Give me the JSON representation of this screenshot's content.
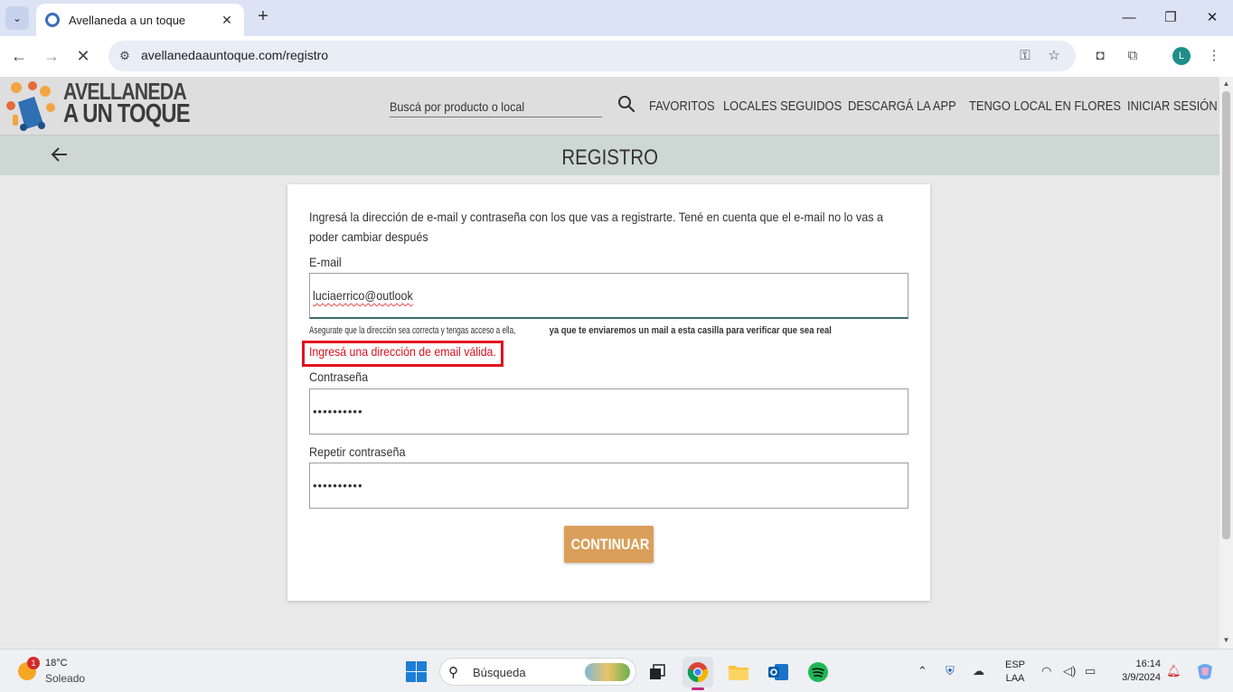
{
  "browser": {
    "tab_title": "Avellaneda a un toque",
    "url": "avellanedaauntoque.com/registro",
    "profile_initial": "L",
    "new_tab": "+",
    "window_controls": {
      "minimize": "—",
      "maximize": "❐",
      "close": "✕"
    }
  },
  "site": {
    "logo_line1": "AVELLANEDA",
    "logo_line2": "A UN TOQUE",
    "search_placeholder": "Buscá por producto o local",
    "menu": [
      "FAVORITOS",
      "LOCALES SEGUIDOS",
      "DESCARGÁ LA APP",
      "TENGO LOCAL EN FLORES",
      "INICIAR SESIÓN"
    ],
    "page_title": "REGISTRO"
  },
  "form": {
    "intro_line1": "Ingresá la dirección de e-mail y contraseña con los que vas a registrarte. Tené en cuenta que el e-mail no lo vas a",
    "intro_line2": "poder cambiar después",
    "email_label": "E-mail",
    "email_value": "luciaerrico@outlook",
    "hint_normal": "Asegurate que la dirección sea correcta y tengas acceso a ella, ",
    "hint_bold": "ya que te enviaremos un mail a esta casilla para verificar que sea real",
    "error": "Ingresá una dirección de email válida.",
    "password_label": "Contraseña",
    "password_value": "••••••••••",
    "repeat_label": "Repetir contraseña",
    "repeat_value": "••••••••••",
    "continue_label": "CONTINUAR"
  },
  "taskbar": {
    "weather_temp": "18°C",
    "weather_desc": "Soleado",
    "weather_badge": "1",
    "search_text": "Búsqueda",
    "lang_line1": "ESP",
    "lang_line2": "LAA",
    "time": "16:14",
    "date": "3/9/2024"
  },
  "colors": {
    "error": "#e0111f",
    "button": "#d99f5a",
    "title_bar": "#cdd7d4"
  }
}
